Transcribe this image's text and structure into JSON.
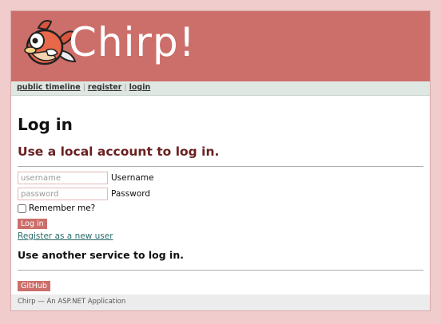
{
  "header": {
    "brand": "Chirp!",
    "logo_icon": "bird-logo-icon",
    "background": "#cc6e6a"
  },
  "nav": {
    "public_timeline": "public timeline",
    "separator": "|",
    "register": "register",
    "login": "login"
  },
  "main": {
    "title": "Log in",
    "subtitle": "Use a local account to log in.",
    "username": {
      "placeholder": "username",
      "label": "Username"
    },
    "password": {
      "placeholder": "password",
      "label": "Password"
    },
    "remember_label": "Remember me?",
    "login_button": "Log in",
    "register_link": "Register as a new user",
    "external_heading": "Use another service to log in.",
    "github_button": "GitHub"
  },
  "footer": {
    "text": "Chirp — An ASP.NET Application"
  }
}
